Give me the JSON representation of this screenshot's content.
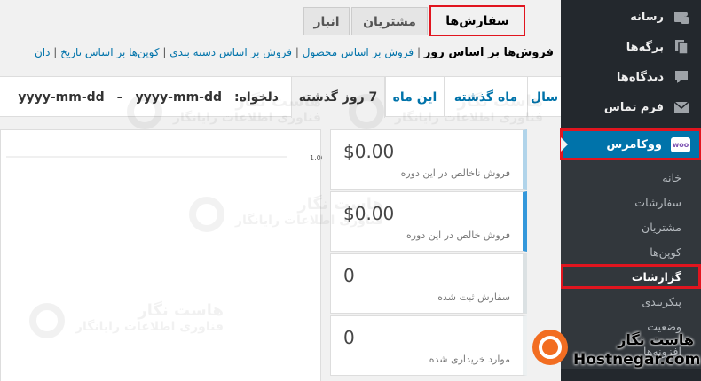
{
  "sidebar": {
    "items": [
      {
        "label": "رسانه",
        "icon": "media-icon"
      },
      {
        "label": "برگه‌ها",
        "icon": "pages-icon"
      },
      {
        "label": "دیدگاه‌ها",
        "icon": "comments-icon"
      },
      {
        "label": "فرم تماس",
        "icon": "mail-icon"
      }
    ],
    "woo": {
      "label": "ووکامرس",
      "badge": "woo"
    },
    "submenu": [
      "خانه",
      "سفارشات",
      "مشتریان",
      "کوپن‌ها",
      "گزارشات",
      "پیکربندی",
      "وضعیت",
      "افزونه‌ها"
    ]
  },
  "tabs": {
    "orders": "سفارش‌ها",
    "customers": "مشتریان",
    "stock": "انبار"
  },
  "sublinks": {
    "current": "فروش‌ها بر اساس روز",
    "by_product": "فروش بر اساس محصول",
    "by_category": "فروش بر اساس دسته بندی",
    "coupons_by_date": "کوپن‌ها بر اساس تاریخ",
    "cut": "دان"
  },
  "ranges": {
    "year": "سال",
    "last_month": "ماه گذشته",
    "this_month": "این ماه",
    "last_7": "7 روز گذشته",
    "custom": "دلخواه:",
    "from": "yyyy-mm-dd",
    "dash": "–",
    "to": "yyyy-mm-dd"
  },
  "stats": [
    {
      "value": "$0.00",
      "label": "فروش ناخالص در این دوره",
      "color": "#b1d4ea"
    },
    {
      "value": "$0.00",
      "label": "فروش خالص در این دوره",
      "color": "#3498db"
    },
    {
      "value": "0",
      "label": "سفارش ثبت شده",
      "color": "#dbe1e3"
    },
    {
      "value": "0",
      "label": "موارد خریداری شده",
      "color": "#ecf0f1"
    }
  ],
  "chart_data": {
    "type": "line",
    "yticks": [
      "1.00"
    ]
  },
  "watermark": {
    "title": "هاست نگار",
    "subtitle": "فناوری اطلاعات رایانگار"
  },
  "brand": {
    "fa": "هاست نگار",
    "en": "Hostnegar.com"
  },
  "colors": {
    "sidebar": "#23282d",
    "accent": "#0073aa",
    "highlight": "#e1151f",
    "brand": "#f26d21"
  }
}
